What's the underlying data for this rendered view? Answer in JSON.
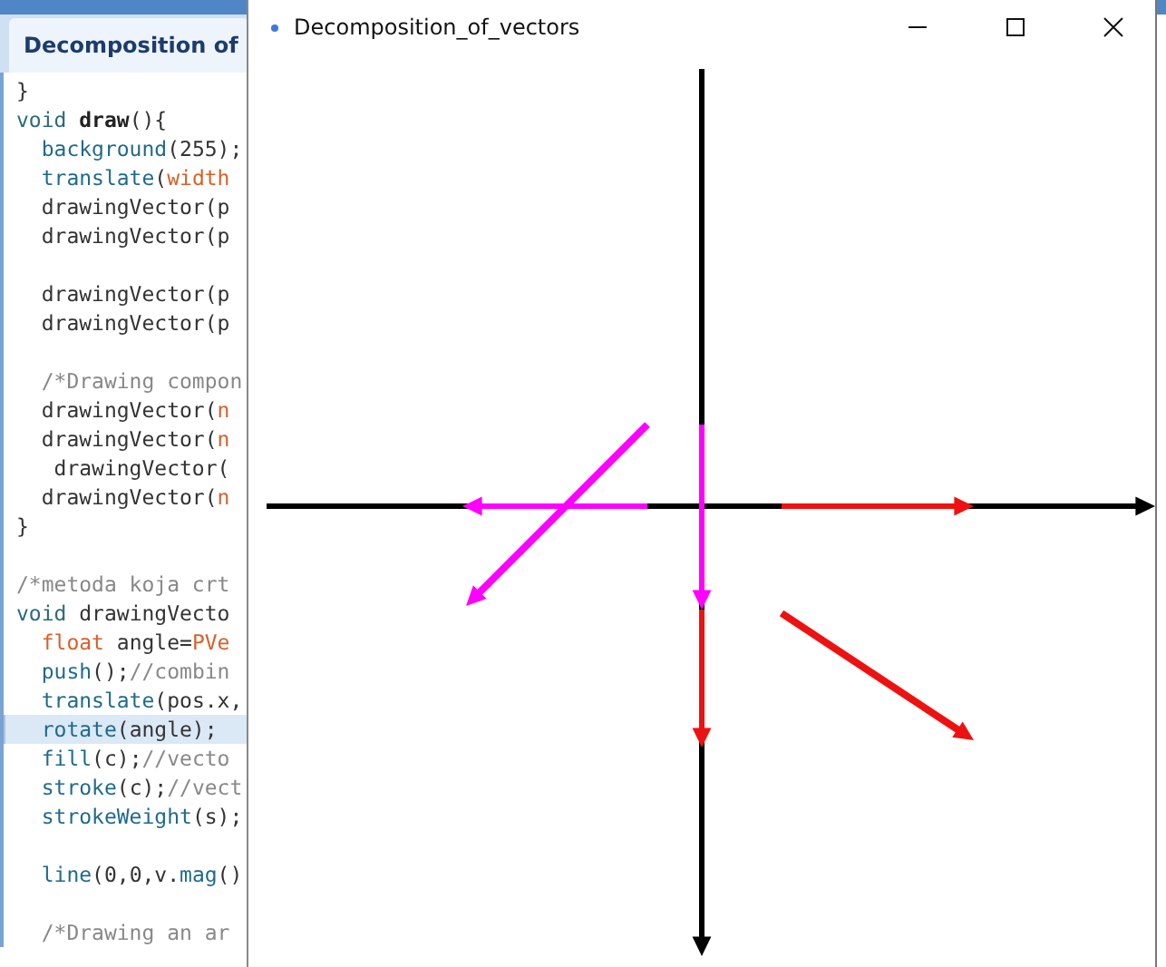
{
  "editor": {
    "tab": {
      "label": "Decomposition of",
      "selected": true
    },
    "lines": [
      {
        "kind": "code",
        "tokens": [
          {
            "kind": "plain",
            "text": "}"
          }
        ],
        "highlighted": false
      },
      {
        "kind": "code",
        "tokens": [
          {
            "kind": "type",
            "text": "void "
          },
          {
            "kind": "bold",
            "text": "draw"
          },
          {
            "kind": "plain",
            "text": "(){"
          }
        ],
        "highlighted": false
      },
      {
        "kind": "code",
        "tokens": [
          {
            "kind": "func",
            "text": "  background"
          },
          {
            "kind": "plain",
            "text": "(255);"
          }
        ],
        "highlighted": false
      },
      {
        "kind": "code",
        "tokens": [
          {
            "kind": "func",
            "text": "  translate"
          },
          {
            "kind": "plain",
            "text": "("
          },
          {
            "kind": "const",
            "text": "width"
          }
        ],
        "highlighted": false
      },
      {
        "kind": "code",
        "tokens": [
          {
            "kind": "plain",
            "text": "  drawingVector(p"
          }
        ],
        "highlighted": false
      },
      {
        "kind": "code",
        "tokens": [
          {
            "kind": "plain",
            "text": "  drawingVector(p"
          }
        ],
        "highlighted": false
      },
      {
        "kind": "blank"
      },
      {
        "kind": "code",
        "tokens": [
          {
            "kind": "plain",
            "text": "  drawingVector(p"
          }
        ],
        "highlighted": false
      },
      {
        "kind": "code",
        "tokens": [
          {
            "kind": "plain",
            "text": "  drawingVector(p"
          }
        ],
        "highlighted": false
      },
      {
        "kind": "blank"
      },
      {
        "kind": "code",
        "tokens": [
          {
            "kind": "comment",
            "text": "  /*Drawing compon"
          }
        ],
        "highlighted": false
      },
      {
        "kind": "code",
        "tokens": [
          {
            "kind": "plain",
            "text": "  drawingVector("
          },
          {
            "kind": "const",
            "text": "n"
          }
        ],
        "highlighted": false
      },
      {
        "kind": "code",
        "tokens": [
          {
            "kind": "plain",
            "text": "  drawingVector("
          },
          {
            "kind": "const",
            "text": "n"
          }
        ],
        "highlighted": false
      },
      {
        "kind": "code",
        "tokens": [
          {
            "kind": "plain",
            "text": "   drawingVector("
          }
        ],
        "highlighted": false
      },
      {
        "kind": "code",
        "tokens": [
          {
            "kind": "plain",
            "text": "  drawingVector("
          },
          {
            "kind": "const",
            "text": "n"
          }
        ],
        "highlighted": false
      },
      {
        "kind": "code",
        "tokens": [
          {
            "kind": "plain",
            "text": "}"
          }
        ],
        "highlighted": false
      },
      {
        "kind": "blank"
      },
      {
        "kind": "code",
        "tokens": [
          {
            "kind": "comment",
            "text": "/*metoda koja crt"
          }
        ],
        "highlighted": false
      },
      {
        "kind": "code",
        "tokens": [
          {
            "kind": "type",
            "text": "void "
          },
          {
            "kind": "plain",
            "text": "drawingVecto"
          }
        ],
        "highlighted": false
      },
      {
        "kind": "code",
        "tokens": [
          {
            "kind": "const",
            "text": "  float"
          },
          {
            "kind": "plain",
            "text": " angle="
          },
          {
            "kind": "const",
            "text": "PVe"
          }
        ],
        "highlighted": false
      },
      {
        "kind": "code",
        "tokens": [
          {
            "kind": "func",
            "text": "  push"
          },
          {
            "kind": "plain",
            "text": "();"
          },
          {
            "kind": "comment",
            "text": "//combin"
          }
        ],
        "highlighted": false
      },
      {
        "kind": "code",
        "tokens": [
          {
            "kind": "func",
            "text": "  translate"
          },
          {
            "kind": "plain",
            "text": "(pos.x,"
          }
        ],
        "highlighted": false
      },
      {
        "kind": "code",
        "tokens": [
          {
            "kind": "func",
            "text": "  rotate"
          },
          {
            "kind": "plain",
            "text": "(angle);"
          }
        ],
        "highlighted": true
      },
      {
        "kind": "code",
        "tokens": [
          {
            "kind": "func",
            "text": "  fill"
          },
          {
            "kind": "plain",
            "text": "(c);"
          },
          {
            "kind": "comment",
            "text": "//vecto"
          }
        ],
        "highlighted": false
      },
      {
        "kind": "code",
        "tokens": [
          {
            "kind": "func",
            "text": "  stroke"
          },
          {
            "kind": "plain",
            "text": "(c);"
          },
          {
            "kind": "comment",
            "text": "//vect"
          }
        ],
        "highlighted": false
      },
      {
        "kind": "code",
        "tokens": [
          {
            "kind": "func",
            "text": "  strokeWeight"
          },
          {
            "kind": "plain",
            "text": "(s);"
          }
        ],
        "highlighted": false
      },
      {
        "kind": "blank"
      },
      {
        "kind": "code",
        "tokens": [
          {
            "kind": "func",
            "text": "  line"
          },
          {
            "kind": "plain",
            "text": "(0,0,v."
          },
          {
            "kind": "func",
            "text": "mag"
          },
          {
            "kind": "plain",
            "text": "()"
          }
        ],
        "highlighted": false
      },
      {
        "kind": "blank"
      },
      {
        "kind": "code",
        "tokens": [
          {
            "kind": "comment",
            "text": "  /*Drawing an ar"
          }
        ],
        "highlighted": false
      }
    ]
  },
  "sketch_window": {
    "title": "Decomposition_of_vectors"
  }
}
